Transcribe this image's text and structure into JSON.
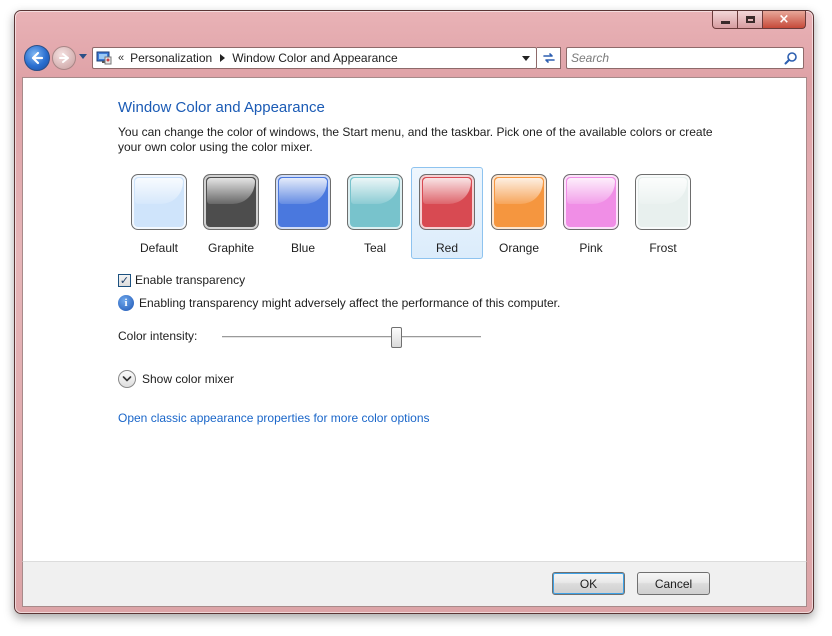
{
  "window": {
    "caption": {
      "minimize": "minimize",
      "maximize": "maximize",
      "close": "×"
    }
  },
  "nav": {
    "chevron": "«",
    "breadcrumb": [
      "Personalization",
      "Window Color and Appearance"
    ],
    "search_placeholder": "Search"
  },
  "main": {
    "title": "Window Color and Appearance",
    "description": "You can change the color of windows, the Start menu, and the taskbar. Pick one of the available colors or create your own color using the color mixer.",
    "swatches": [
      {
        "label": "Default",
        "color": "#cfe4fb",
        "selected": false
      },
      {
        "label": "Graphite",
        "color": "#4d4d4d",
        "selected": false
      },
      {
        "label": "Blue",
        "color": "#4a78de",
        "selected": false
      },
      {
        "label": "Teal",
        "color": "#78c3cc",
        "selected": false
      },
      {
        "label": "Red",
        "color": "#d84a52",
        "selected": true
      },
      {
        "label": "Orange",
        "color": "#f5963f",
        "selected": false
      },
      {
        "label": "Pink",
        "color": "#f08ee6",
        "selected": false
      },
      {
        "label": "Frost",
        "color": "#e8f0ee",
        "selected": false
      }
    ],
    "transparency": {
      "label": "Enable transparency",
      "checked": true,
      "check_glyph": "✓"
    },
    "info_text": "Enabling transparency might adversely affect the performance of this computer.",
    "intensity": {
      "label": "Color intensity:",
      "value_fraction": 0.67
    },
    "mixer_label": "Show color mixer",
    "classic_link": "Open classic appearance properties for more color options"
  },
  "footer": {
    "ok": "OK",
    "cancel": "Cancel"
  },
  "colors": {
    "accent_link": "#1a66c9",
    "heading": "#1b5bb5",
    "frame": "#dea1a6"
  }
}
